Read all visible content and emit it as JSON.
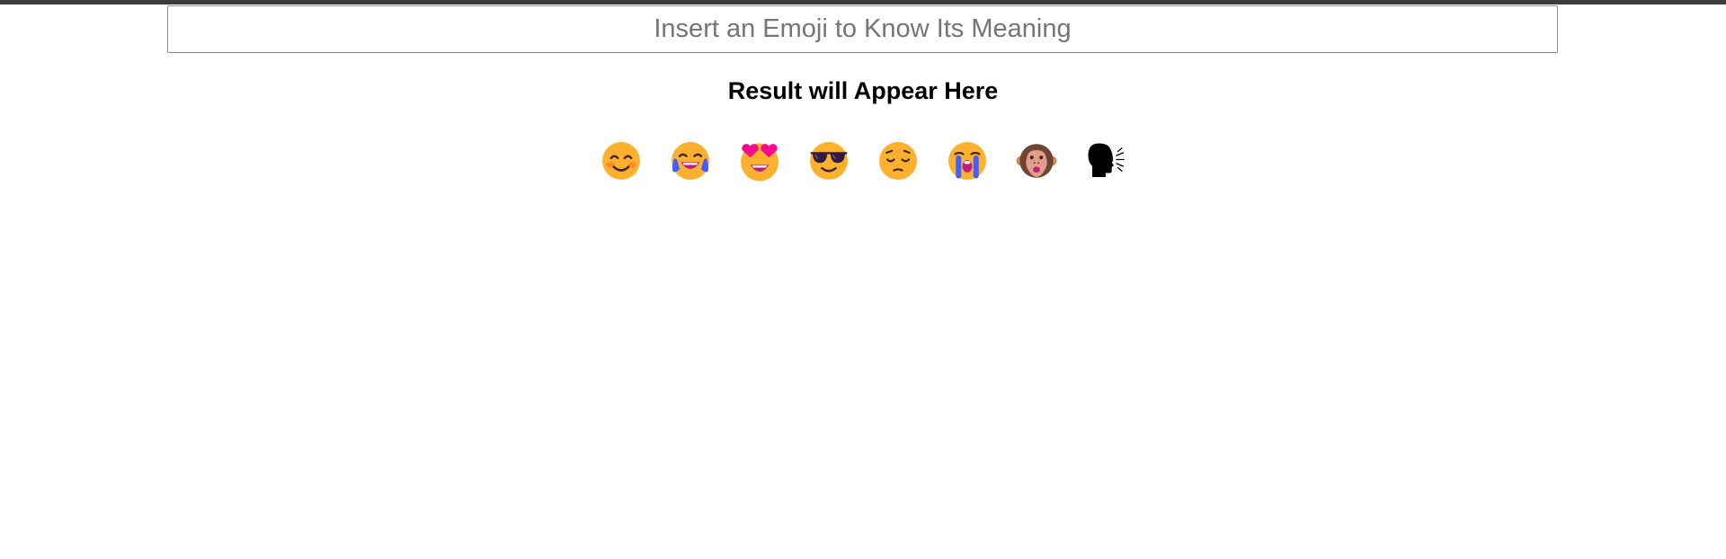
{
  "search": {
    "placeholder": "Insert an Emoji to Know Its Meaning",
    "value": ""
  },
  "result": {
    "text": "Result will Appear Here"
  },
  "emojis": [
    {
      "char": "😊",
      "icon": "smiling-face-with-smiling-eyes-icon"
    },
    {
      "char": "😂",
      "icon": "face-with-tears-of-joy-icon"
    },
    {
      "char": "😍",
      "icon": "smiling-face-with-heart-eyes-icon"
    },
    {
      "char": "😎",
      "icon": "smiling-face-with-sunglasses-icon"
    },
    {
      "char": "😔",
      "icon": "pensive-face-icon"
    },
    {
      "char": "😭",
      "icon": "loudly-crying-face-icon"
    },
    {
      "char": "🐵",
      "icon": "monkey-face-icon"
    },
    {
      "char": "🗣",
      "icon": "speaking-head-icon"
    }
  ],
  "colors": {
    "face": "#FFB02E",
    "top_bar": "#3c3c3c"
  }
}
